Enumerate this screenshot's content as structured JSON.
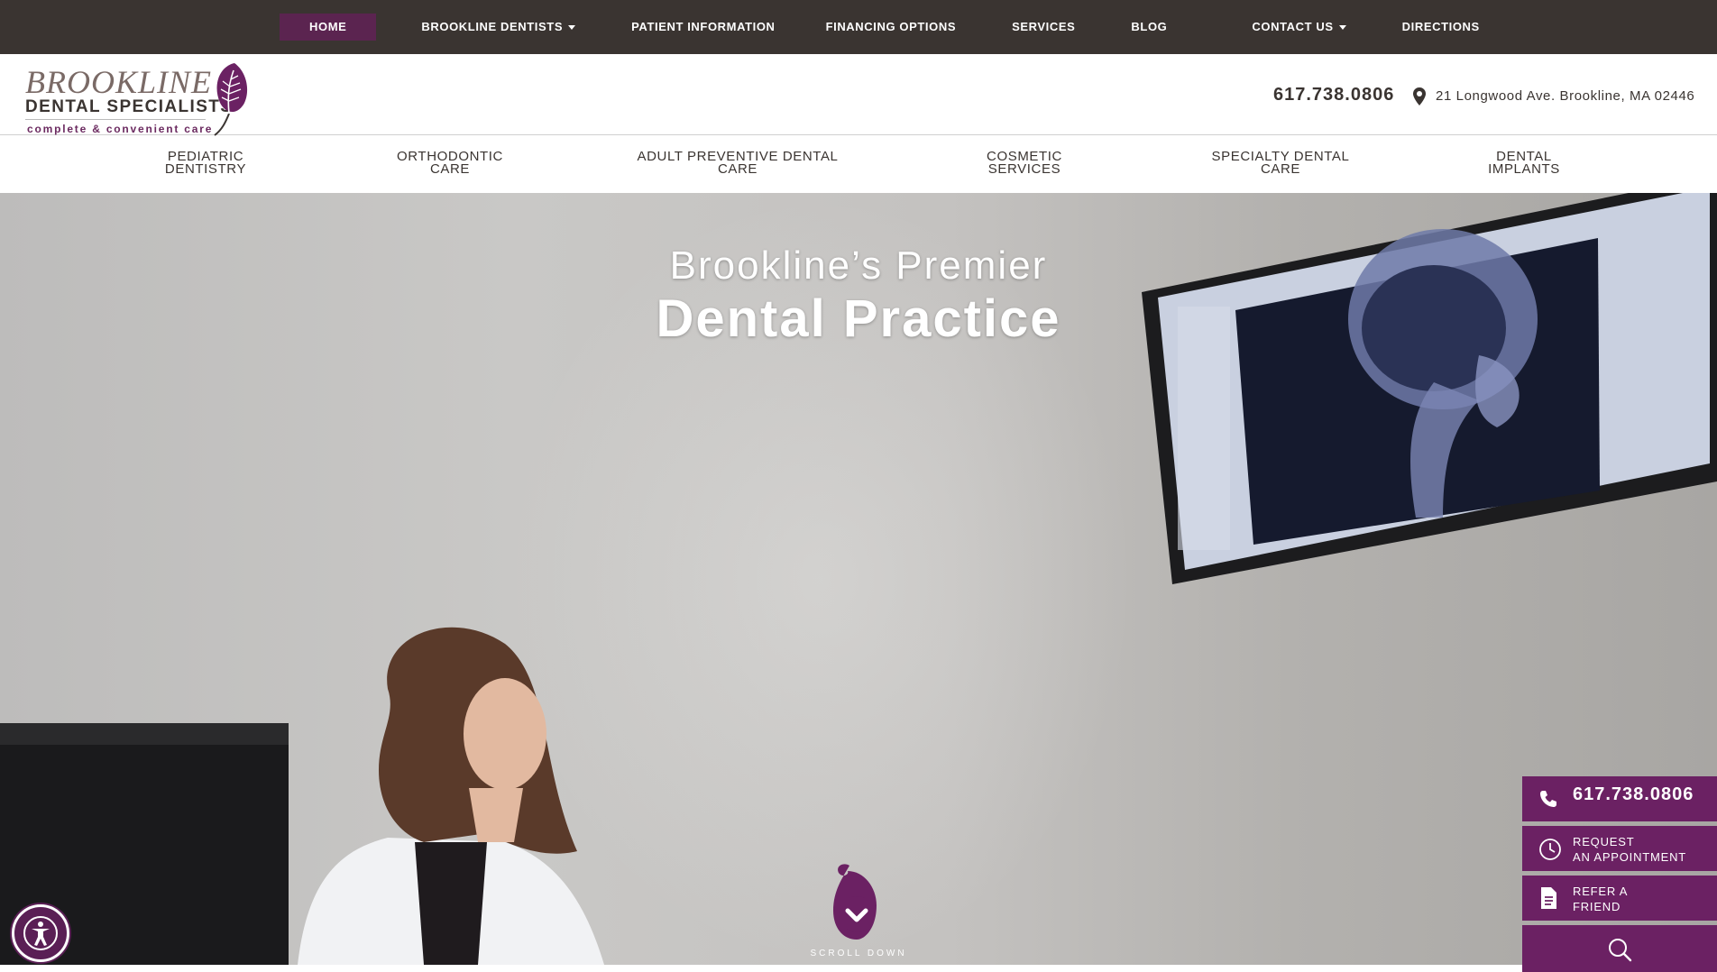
{
  "topnav": {
    "items": [
      {
        "label": "HOME",
        "active": true
      },
      {
        "label": "BROOKLINE DENTISTS",
        "dropdown": true
      },
      {
        "label": "PATIENT INFORMATION"
      },
      {
        "label": "FINANCING OPTIONS"
      },
      {
        "label": "SERVICES"
      },
      {
        "label": "BLOG"
      },
      {
        "label": "CONTACT US",
        "dropdown": true
      },
      {
        "label": "DIRECTIONS"
      }
    ]
  },
  "header": {
    "logo": {
      "word": "BROOKLINE",
      "sub": "DENTAL SPECIALISTS",
      "tagline": "complete & convenient care"
    },
    "phone": "617.738.0806",
    "address": "21 Longwood Ave. Brookline, MA 02446",
    "address_icon": "map-pin-icon"
  },
  "servnav": {
    "items": [
      {
        "line1": "PEDIATRIC",
        "line2": "DENTISTRY"
      },
      {
        "line1": "ORTHODONTIC",
        "line2": "CARE"
      },
      {
        "line1": "ADULT PREVENTIVE DENTAL",
        "line2": "CARE"
      },
      {
        "line1": "COSMETIC",
        "line2": "SERVICES"
      },
      {
        "line1": "SPECIALTY DENTAL",
        "line2": "CARE"
      },
      {
        "line1": "DENTAL",
        "line2": "IMPLANTS"
      }
    ]
  },
  "hero": {
    "line1": "Brookline’s Premier",
    "line2": "Dental Practice",
    "scroll_label": "SCROLL DOWN",
    "scroll_icon": "chevron-down-icon"
  },
  "cta": {
    "phone": "617.738.0806",
    "appointment_line1": "REQUEST",
    "appointment_line2": "AN APPOINTMENT",
    "refer_line1": "REFER A",
    "refer_line2": "FRIEND",
    "icons": [
      "phone-icon",
      "clock-icon",
      "document-icon",
      "search-icon"
    ]
  },
  "colors": {
    "brand_purple": "#6b2163",
    "topbar": "#3a3431",
    "active_nav": "#5b2450"
  }
}
